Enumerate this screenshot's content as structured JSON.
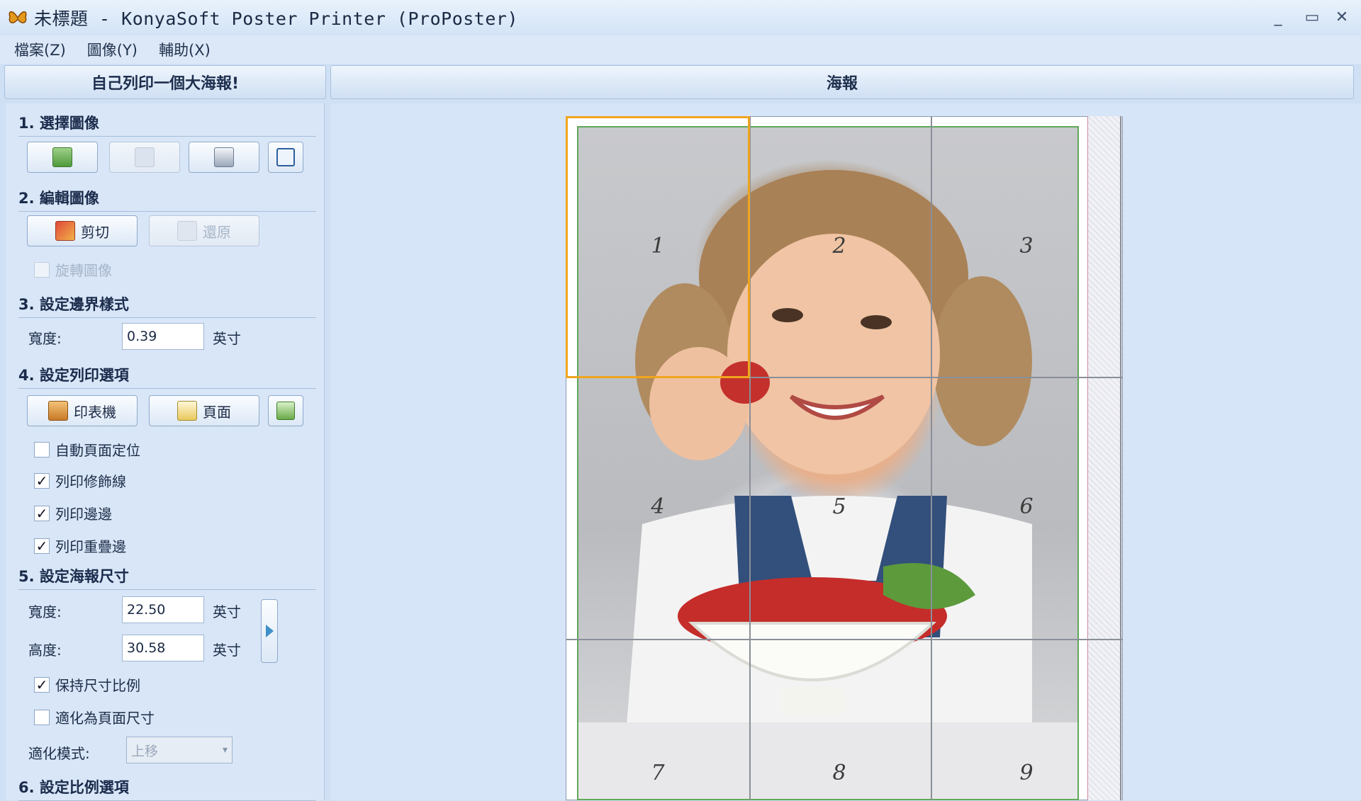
{
  "window": {
    "title": "未標題 - KonyaSoft Poster Printer (ProPoster)",
    "app_icon": "butterfly-icon",
    "controls": [
      "minimize-icon",
      "maximize-icon",
      "close-icon"
    ],
    "min_glyph": "_",
    "max_glyph": "▭",
    "close_glyph": "✕"
  },
  "menu": [
    "檔案(Z)",
    "圖像(Y)",
    "輔助(X)"
  ],
  "headers": {
    "left": "自己列印一個大海報!",
    "right": "海報"
  },
  "sections": {
    "s1": "1. 選擇圖像",
    "s2": "2. 編輯圖像",
    "s3": "3. 設定邊界樣式",
    "s4": "4. 設定列印選項",
    "s5": "5. 設定海報尺寸",
    "s6": "6. 設定比例選項"
  },
  "edit": {
    "crop": "剪切",
    "restore": "還原",
    "rotate": "旋轉圖像"
  },
  "border": {
    "width_label": "寬度:",
    "width_value": "0.39",
    "unit": "英寸"
  },
  "print": {
    "printer": "印表機",
    "page": "頁面",
    "options": [
      {
        "label": "自動頁面定位",
        "checked": false
      },
      {
        "label": "列印修飾線",
        "checked": true
      },
      {
        "label": "列印邊邊",
        "checked": true
      },
      {
        "label": "列印重疊邊",
        "checked": true
      }
    ]
  },
  "poster_size": {
    "width_label": "寬度:",
    "width_value": "22.50",
    "height_label": "高度:",
    "height_value": "30.58",
    "unit": "英寸",
    "keep_ratio": "保持尺寸比例",
    "fit_page": "適化為頁面尺寸",
    "fit_mode_label": "適化模式:",
    "fit_mode_value": "上移"
  },
  "check_glyph": "✓",
  "tiles": [
    "1",
    "2",
    "3",
    "4",
    "5",
    "6",
    "7",
    "8",
    "9"
  ],
  "colors": {
    "accent_selection": "#f0a51e",
    "margin_line": "#5fa85a",
    "grid_line": "#8a8f98"
  }
}
